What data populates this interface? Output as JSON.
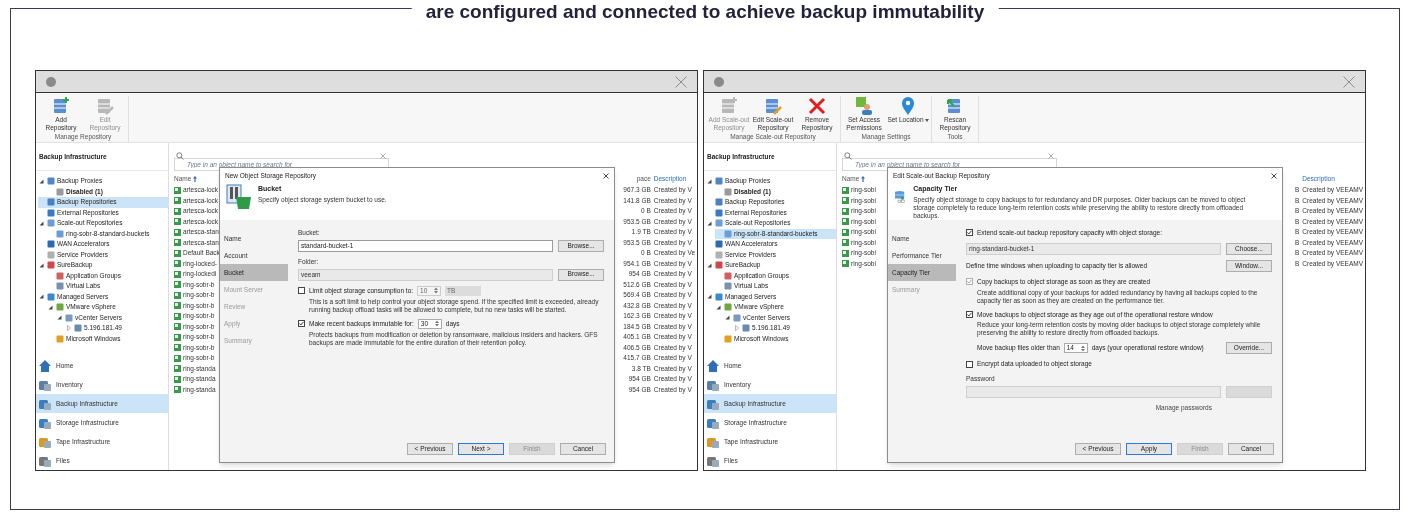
{
  "caption": "are configured and connected to achieve backup immutability",
  "windows": [
    {
      "ribbon": {
        "groups": [
          {
            "label": "Manage Repository",
            "buttons": [
              {
                "label": "Add Repository",
                "kind": "add",
                "disabled": false
              },
              {
                "label": "Edit Repository",
                "kind": "edit",
                "disabled": true
              }
            ]
          }
        ]
      },
      "sidebar": {
        "title": "Backup Infrastructure",
        "tree": [
          {
            "label": "Backup Proxies",
            "kind": "proxy",
            "selected": false,
            "expanded": true,
            "children": [
              {
                "label": "Disabled (1)",
                "kind": "disabled",
                "selected": false,
                "bold": true
              }
            ]
          },
          {
            "label": "Backup Repositories",
            "kind": "repo",
            "selected": true
          },
          {
            "label": "External Repositories",
            "kind": "external",
            "selected": false
          },
          {
            "label": "Scale-out Repositories",
            "kind": "sobr",
            "selected": false,
            "expanded": true,
            "children": [
              {
                "label": "ring-sobr-8-standard-buckets",
                "kind": "sobr",
                "selected": false
              }
            ]
          },
          {
            "label": "WAN Accelerators",
            "kind": "wan",
            "selected": false
          },
          {
            "label": "Service Providers",
            "kind": "provider",
            "selected": false
          },
          {
            "label": "SureBackup",
            "kind": "surebackup",
            "selected": false,
            "expanded": true,
            "children": [
              {
                "label": "Application Groups",
                "kind": "appgroup",
                "selected": false
              },
              {
                "label": "Virtual Labs",
                "kind": "lab",
                "selected": false
              }
            ]
          },
          {
            "label": "Managed Servers",
            "kind": "servers",
            "selected": false,
            "expanded": true,
            "children": [
              {
                "label": "VMware vSphere",
                "kind": "vsphere",
                "selected": false,
                "expanded": true,
                "children": [
                  {
                    "label": "vCenter Servers",
                    "kind": "vcenter",
                    "selected": false,
                    "expanded": true,
                    "children": [
                      {
                        "label": "5.196.181.49",
                        "kind": "host",
                        "selected": false,
                        "expanded": false
                      }
                    ]
                  }
                ]
              },
              {
                "label": "Microsoft Windows",
                "kind": "windows",
                "selected": false
              }
            ]
          }
        ],
        "nav": [
          {
            "label": "Home",
            "kind": "home",
            "selected": false
          },
          {
            "label": "Inventory",
            "kind": "inventory",
            "selected": false
          },
          {
            "label": "Backup Infrastructure",
            "kind": "backup",
            "selected": true
          },
          {
            "label": "Storage Infrastructure",
            "kind": "storage",
            "selected": false
          },
          {
            "label": "Tape Infrastructure",
            "kind": "tape",
            "selected": false
          },
          {
            "label": "Files",
            "kind": "files",
            "selected": false
          }
        ]
      },
      "search": {
        "placeholder": "Type in an object name to search for"
      },
      "table": {
        "columns": [
          {
            "heading": "Name",
            "cells": [
              "artesca-lock",
              "artesca-lock",
              "artesca-lock",
              "artesca-lock",
              "artesca-stan",
              "artesca-stan",
              "Default Back",
              "ring-locked-",
              "ring-lockedi",
              "ring-sobr-b",
              "ring-sobr-b",
              "ring-sobr-b",
              "ring-sobr-b",
              "ring-sobr-b",
              "ring-sobr-b",
              "ring-sobr-b",
              "ring-sobr-b",
              "ring-standa",
              "ring-standa",
              "ring-standa"
            ]
          },
          {
            "heading": "pace",
            "cells": [
              "967.3 GB",
              "141.8 GB",
              "0 B",
              "953.5 GB",
              "1.9 TB",
              "953.5 GB",
              "0 B",
              "954.1 GB",
              "954 GB",
              "512.6 GB",
              "569.4 GB",
              "432.8 GB",
              "162.3 GB",
              "184.5 GB",
              "405.1 GB",
              "406.5 GB",
              "415.7 GB",
              "3.8 TB",
              "954 GB",
              "954 GB"
            ]
          },
          {
            "heading": "Description",
            "cells": [
              "Created by V",
              "Created by V",
              "Created by V",
              "Created by V",
              "Created by V",
              "Created by V",
              "Created by Ve",
              "Created by V",
              "Created by V",
              "Created by V",
              "Created by V",
              "Created by V",
              "Created by V",
              "Created by V",
              "Created by V",
              "Created by V",
              "Created by V",
              "Created by V",
              "Created by V",
              "Created by V"
            ]
          }
        ]
      },
      "dialog": {
        "title": "New Object Storage Repository",
        "kind": "bucket",
        "heading": "Bucket",
        "subtitle": "Specify object storage system bucket to use.",
        "steps": [
          {
            "label": "Name",
            "selected": false
          },
          {
            "label": "Account",
            "selected": false
          },
          {
            "label": "Bucket",
            "selected": true
          },
          {
            "label": "Mount Server",
            "selected": false
          },
          {
            "label": "Review",
            "selected": false
          },
          {
            "label": "Apply",
            "selected": false
          },
          {
            "label": "Summary",
            "selected": false
          }
        ],
        "items": [
          {
            "kind": "input",
            "label": "Bucket:",
            "value": "standard-bucket-1",
            "disabled": false,
            "button": {
              "label": "Browse...",
              "disabled": false
            }
          },
          {
            "kind": "input",
            "label": "Folder:",
            "value": "veeam",
            "disabled": true,
            "button": {
              "label": "Browse...",
              "disabled": false
            }
          },
          {
            "kind": "check",
            "label": "Limit object storage consumption to:",
            "checked": false,
            "disabled": false,
            "spin": {
              "value": "10",
              "unit": "TB",
              "disabled": true
            },
            "note": "This is a soft limit to help control your object storage spend. If the specified limit is exceeded, already running backup offload tasks will be allowed to complete, but no new tasks will be started."
          },
          {
            "kind": "check",
            "label": "Make recent backups immutable for:",
            "checked": true,
            "disabled": false,
            "spin": {
              "value": "30",
              "unit": "days",
              "disabled": false
            },
            "note": "Protects backups from modification or deletion by ransomware, malicious insiders and hackers. GFS backups are made immutable for the entire duration of their retention policy."
          }
        ],
        "buttons": [
          {
            "label": "< Previous",
            "default": false,
            "disabled": false
          },
          {
            "label": "Next >",
            "default": true,
            "disabled": false
          },
          {
            "label": "Finish",
            "default": false,
            "disabled": true
          },
          {
            "label": "Cancel",
            "default": false,
            "disabled": false
          }
        ]
      }
    },
    {
      "ribbon": {
        "groups": [
          {
            "label": "Manage Scale-out Repository",
            "buttons": [
              {
                "label": "Add Scale-out Repository",
                "kind": "add",
                "disabled": true
              },
              {
                "label": "Edit Scale-out Repository",
                "kind": "edit",
                "disabled": false
              },
              {
                "label": "Remove Repository",
                "kind": "remove",
                "disabled": false
              }
            ]
          },
          {
            "label": "Manage Settings",
            "buttons": [
              {
                "label": "Set Access Permissions",
                "kind": "permissions",
                "disabled": false
              },
              {
                "label": "Set Location",
                "kind": "location",
                "disabled": false,
                "dropdown": true
              }
            ]
          },
          {
            "label": "Tools",
            "buttons": [
              {
                "label": "Rescan Repository",
                "kind": "rescan",
                "disabled": false
              }
            ]
          }
        ]
      },
      "sidebar": {
        "title": "Backup Infrastructure",
        "tree": [
          {
            "label": "Backup Proxies",
            "kind": "proxy",
            "selected": false,
            "expanded": true,
            "children": [
              {
                "label": "Disabled (1)",
                "kind": "disabled",
                "selected": false,
                "bold": true
              }
            ]
          },
          {
            "label": "Backup Repositories",
            "kind": "repo",
            "selected": false
          },
          {
            "label": "External Repositories",
            "kind": "external",
            "selected": false
          },
          {
            "label": "Scale-out Repositories",
            "kind": "sobr",
            "selected": false,
            "expanded": true,
            "children": [
              {
                "label": "ring-sobr-8-standard-buckets",
                "kind": "sobr",
                "selected": true
              }
            ]
          },
          {
            "label": "WAN Accelerators",
            "kind": "wan",
            "selected": false
          },
          {
            "label": "Service Providers",
            "kind": "provider",
            "selected": false
          },
          {
            "label": "SureBackup",
            "kind": "surebackup",
            "selected": false,
            "expanded": true,
            "children": [
              {
                "label": "Application Groups",
                "kind": "appgroup",
                "selected": false
              },
              {
                "label": "Virtual Labs",
                "kind": "lab",
                "selected": false
              }
            ]
          },
          {
            "label": "Managed Servers",
            "kind": "servers",
            "selected": false,
            "expanded": true,
            "children": [
              {
                "label": "VMware vSphere",
                "kind": "vsphere",
                "selected": false,
                "expanded": true,
                "children": [
                  {
                    "label": "vCenter Servers",
                    "kind": "vcenter",
                    "selected": false,
                    "expanded": true,
                    "children": [
                      {
                        "label": "5.196.181.49",
                        "kind": "host",
                        "selected": false,
                        "expanded": false
                      }
                    ]
                  }
                ]
              },
              {
                "label": "Microsoft Windows",
                "kind": "windows",
                "selected": false
              }
            ]
          }
        ],
        "nav": [
          {
            "label": "Home",
            "kind": "home",
            "selected": false
          },
          {
            "label": "Inventory",
            "kind": "inventory",
            "selected": false
          },
          {
            "label": "Backup Infrastructure",
            "kind": "backup",
            "selected": true
          },
          {
            "label": "Storage Infrastructure",
            "kind": "storage",
            "selected": false
          },
          {
            "label": "Tape Infrastructure",
            "kind": "tape",
            "selected": false
          },
          {
            "label": "Files",
            "kind": "files",
            "selected": false
          }
        ]
      },
      "search": {
        "placeholder": "Type in an object name to search for"
      },
      "table": {
        "columns": [
          {
            "heading": "Name",
            "cells": [
              "ring-sobi",
              "ring-sobi",
              "ring-sobi",
              "ring-sobi",
              "ring-sobi",
              "ring-sobi",
              "ring-sobi",
              "ring-sobi"
            ]
          },
          {
            "cells": [
              "B",
              "B",
              "B",
              "B",
              "B",
              "B",
              "B",
              "B"
            ]
          },
          {
            "heading": "Description",
            "cells": [
              "Created by VEEAMV",
              "Created by VEEAMV",
              "Created by VEEAMV",
              "Created by VEEAMV",
              "Created by VEEAMV",
              "Created by VEEAMV",
              "Created by VEEAMV",
              "Created by VEEAMV"
            ]
          }
        ]
      },
      "dialog": {
        "title": "Edit Scale-out Backup Repository",
        "kind": "tier",
        "heading": "Capacity Tier",
        "subtitle": "Specify object storage to copy backups to for redundancy and DR purposes. Older backups can be moved to object storage completely to reduce long-term retention costs while preserving the ability to restore directly from offloaded backups.",
        "steps": [
          {
            "label": "Name",
            "selected": false
          },
          {
            "label": "Performance Tier",
            "selected": false
          },
          {
            "label": "Capacity Tier",
            "selected": true
          },
          {
            "label": "Summary",
            "selected": false
          }
        ],
        "items": [
          {
            "kind": "check",
            "label": "Extend scale-out backup repository capacity with object storage:",
            "checked": true,
            "disabled": false
          },
          {
            "kind": "input",
            "value": "ring-standard-bucket-1",
            "disabled": true,
            "button": {
              "label": "Choose...",
              "disabled": false
            }
          },
          {
            "kind": "text",
            "text": "Define time windows when uploading to capacity tier is allowed",
            "button": {
              "label": "Window...",
              "disabled": false
            }
          },
          {
            "kind": "check",
            "label": "Copy backups to object storage as soon as they are created",
            "checked": true,
            "disabled": true,
            "note": "Create additional copy of your backups for added redundancy by having all backups copied to the capacity tier as soon as they are created on the performance tier."
          },
          {
            "kind": "check",
            "label": "Move backups to object storage as they age out of the operational restore window",
            "checked": true,
            "disabled": false,
            "note": "Reduce your long-term retention costs by moving older backups to object storage completely while preserving the ability to restore directly from offloaded backups."
          },
          {
            "kind": "spinrow",
            "before": "Move backup files older than",
            "value": "14",
            "after": "days (your operational restore window)",
            "button": {
              "label": "Override...",
              "disabled": false
            }
          },
          {
            "kind": "check",
            "label": "Encrypt data uploaded to object storage",
            "checked": false,
            "disabled": false
          },
          {
            "kind": "input",
            "label": "Password",
            "value": "",
            "disabled": true,
            "button": {
              "disabled": true
            }
          },
          {
            "kind": "link",
            "text": "Manage passwords"
          }
        ],
        "buttons": [
          {
            "label": "< Previous",
            "default": false,
            "disabled": false
          },
          {
            "label": "Apply",
            "default": true,
            "disabled": false
          },
          {
            "label": "Finish",
            "default": false,
            "disabled": true
          },
          {
            "label": "Cancel",
            "default": false,
            "disabled": false
          }
        ]
      }
    }
  ]
}
